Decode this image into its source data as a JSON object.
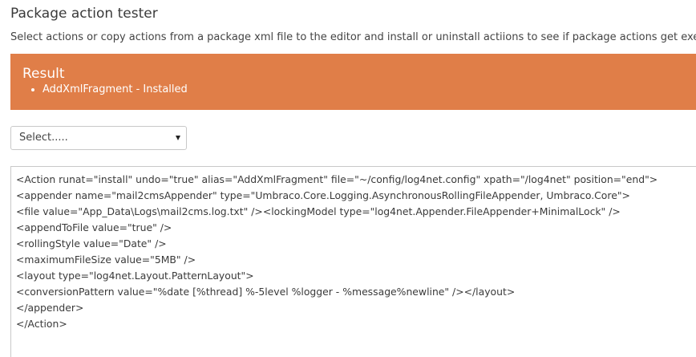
{
  "page": {
    "title": "Package action tester",
    "description": "Select actions or copy actions from a package xml file to the editor and install or uninstall actiions to see if package actions get exec"
  },
  "result": {
    "heading": "Result",
    "items": [
      "AddXmlFragment - Installed"
    ],
    "background_color": "#e07e48"
  },
  "action_select": {
    "selected": "Select.....",
    "icon": "chevron-down-icon"
  },
  "editor": {
    "lines": [
      "<Action runat=\"install\" undo=\"true\" alias=\"AddXmlFragment\" file=\"~/config/log4net.config\" xpath=\"/log4net\" position=\"end\">",
      "<appender name=\"mail2cmsAppender\" type=\"Umbraco.Core.Logging.AsynchronousRollingFileAppender, Umbraco.Core\">",
      "<file value=\"App_Data\\Logs\\mail2cms.log.txt\" /><lockingModel type=\"log4net.Appender.FileAppender+MinimalLock\" />",
      "<appendToFile value=\"true\" />",
      "<rollingStyle value=\"Date\" />",
      "<maximumFileSize value=\"5MB\" />",
      "<layout type=\"log4net.Layout.PatternLayout\">",
      "<conversionPattern value=\"%date [%thread] %-5level %logger - %message%newline\" /></layout>",
      "</appender>",
      "</Action>"
    ]
  }
}
